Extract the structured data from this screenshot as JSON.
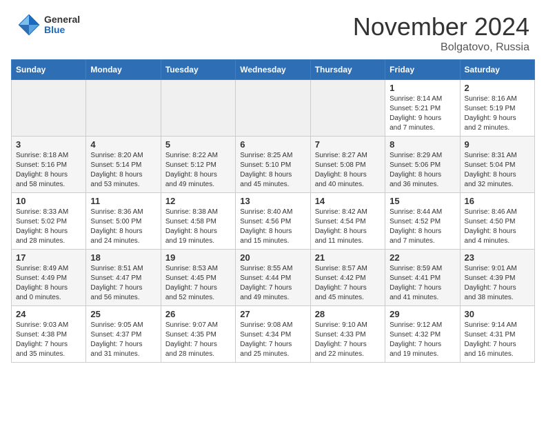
{
  "logo": {
    "general": "General",
    "blue": "Blue"
  },
  "title": {
    "month": "November 2024",
    "location": "Bolgatovo, Russia"
  },
  "headers": [
    "Sunday",
    "Monday",
    "Tuesday",
    "Wednesday",
    "Thursday",
    "Friday",
    "Saturday"
  ],
  "weeks": [
    [
      {
        "day": "",
        "info": "",
        "empty": true
      },
      {
        "day": "",
        "info": "",
        "empty": true
      },
      {
        "day": "",
        "info": "",
        "empty": true
      },
      {
        "day": "",
        "info": "",
        "empty": true
      },
      {
        "day": "",
        "info": "",
        "empty": true
      },
      {
        "day": "1",
        "info": "Sunrise: 8:14 AM\nSunset: 5:21 PM\nDaylight: 9 hours\nand 7 minutes."
      },
      {
        "day": "2",
        "info": "Sunrise: 8:16 AM\nSunset: 5:19 PM\nDaylight: 9 hours\nand 2 minutes."
      }
    ],
    [
      {
        "day": "3",
        "info": "Sunrise: 8:18 AM\nSunset: 5:16 PM\nDaylight: 8 hours\nand 58 minutes."
      },
      {
        "day": "4",
        "info": "Sunrise: 8:20 AM\nSunset: 5:14 PM\nDaylight: 8 hours\nand 53 minutes."
      },
      {
        "day": "5",
        "info": "Sunrise: 8:22 AM\nSunset: 5:12 PM\nDaylight: 8 hours\nand 49 minutes."
      },
      {
        "day": "6",
        "info": "Sunrise: 8:25 AM\nSunset: 5:10 PM\nDaylight: 8 hours\nand 45 minutes."
      },
      {
        "day": "7",
        "info": "Sunrise: 8:27 AM\nSunset: 5:08 PM\nDaylight: 8 hours\nand 40 minutes."
      },
      {
        "day": "8",
        "info": "Sunrise: 8:29 AM\nSunset: 5:06 PM\nDaylight: 8 hours\nand 36 minutes."
      },
      {
        "day": "9",
        "info": "Sunrise: 8:31 AM\nSunset: 5:04 PM\nDaylight: 8 hours\nand 32 minutes."
      }
    ],
    [
      {
        "day": "10",
        "info": "Sunrise: 8:33 AM\nSunset: 5:02 PM\nDaylight: 8 hours\nand 28 minutes."
      },
      {
        "day": "11",
        "info": "Sunrise: 8:36 AM\nSunset: 5:00 PM\nDaylight: 8 hours\nand 24 minutes."
      },
      {
        "day": "12",
        "info": "Sunrise: 8:38 AM\nSunset: 4:58 PM\nDaylight: 8 hours\nand 19 minutes."
      },
      {
        "day": "13",
        "info": "Sunrise: 8:40 AM\nSunset: 4:56 PM\nDaylight: 8 hours\nand 15 minutes."
      },
      {
        "day": "14",
        "info": "Sunrise: 8:42 AM\nSunset: 4:54 PM\nDaylight: 8 hours\nand 11 minutes."
      },
      {
        "day": "15",
        "info": "Sunrise: 8:44 AM\nSunset: 4:52 PM\nDaylight: 8 hours\nand 7 minutes."
      },
      {
        "day": "16",
        "info": "Sunrise: 8:46 AM\nSunset: 4:50 PM\nDaylight: 8 hours\nand 4 minutes."
      }
    ],
    [
      {
        "day": "17",
        "info": "Sunrise: 8:49 AM\nSunset: 4:49 PM\nDaylight: 8 hours\nand 0 minutes."
      },
      {
        "day": "18",
        "info": "Sunrise: 8:51 AM\nSunset: 4:47 PM\nDaylight: 7 hours\nand 56 minutes."
      },
      {
        "day": "19",
        "info": "Sunrise: 8:53 AM\nSunset: 4:45 PM\nDaylight: 7 hours\nand 52 minutes."
      },
      {
        "day": "20",
        "info": "Sunrise: 8:55 AM\nSunset: 4:44 PM\nDaylight: 7 hours\nand 49 minutes."
      },
      {
        "day": "21",
        "info": "Sunrise: 8:57 AM\nSunset: 4:42 PM\nDaylight: 7 hours\nand 45 minutes."
      },
      {
        "day": "22",
        "info": "Sunrise: 8:59 AM\nSunset: 4:41 PM\nDaylight: 7 hours\nand 41 minutes."
      },
      {
        "day": "23",
        "info": "Sunrise: 9:01 AM\nSunset: 4:39 PM\nDaylight: 7 hours\nand 38 minutes."
      }
    ],
    [
      {
        "day": "24",
        "info": "Sunrise: 9:03 AM\nSunset: 4:38 PM\nDaylight: 7 hours\nand 35 minutes."
      },
      {
        "day": "25",
        "info": "Sunrise: 9:05 AM\nSunset: 4:37 PM\nDaylight: 7 hours\nand 31 minutes."
      },
      {
        "day": "26",
        "info": "Sunrise: 9:07 AM\nSunset: 4:35 PM\nDaylight: 7 hours\nand 28 minutes."
      },
      {
        "day": "27",
        "info": "Sunrise: 9:08 AM\nSunset: 4:34 PM\nDaylight: 7 hours\nand 25 minutes."
      },
      {
        "day": "28",
        "info": "Sunrise: 9:10 AM\nSunset: 4:33 PM\nDaylight: 7 hours\nand 22 minutes."
      },
      {
        "day": "29",
        "info": "Sunrise: 9:12 AM\nSunset: 4:32 PM\nDaylight: 7 hours\nand 19 minutes."
      },
      {
        "day": "30",
        "info": "Sunrise: 9:14 AM\nSunset: 4:31 PM\nDaylight: 7 hours\nand 16 minutes."
      }
    ]
  ]
}
